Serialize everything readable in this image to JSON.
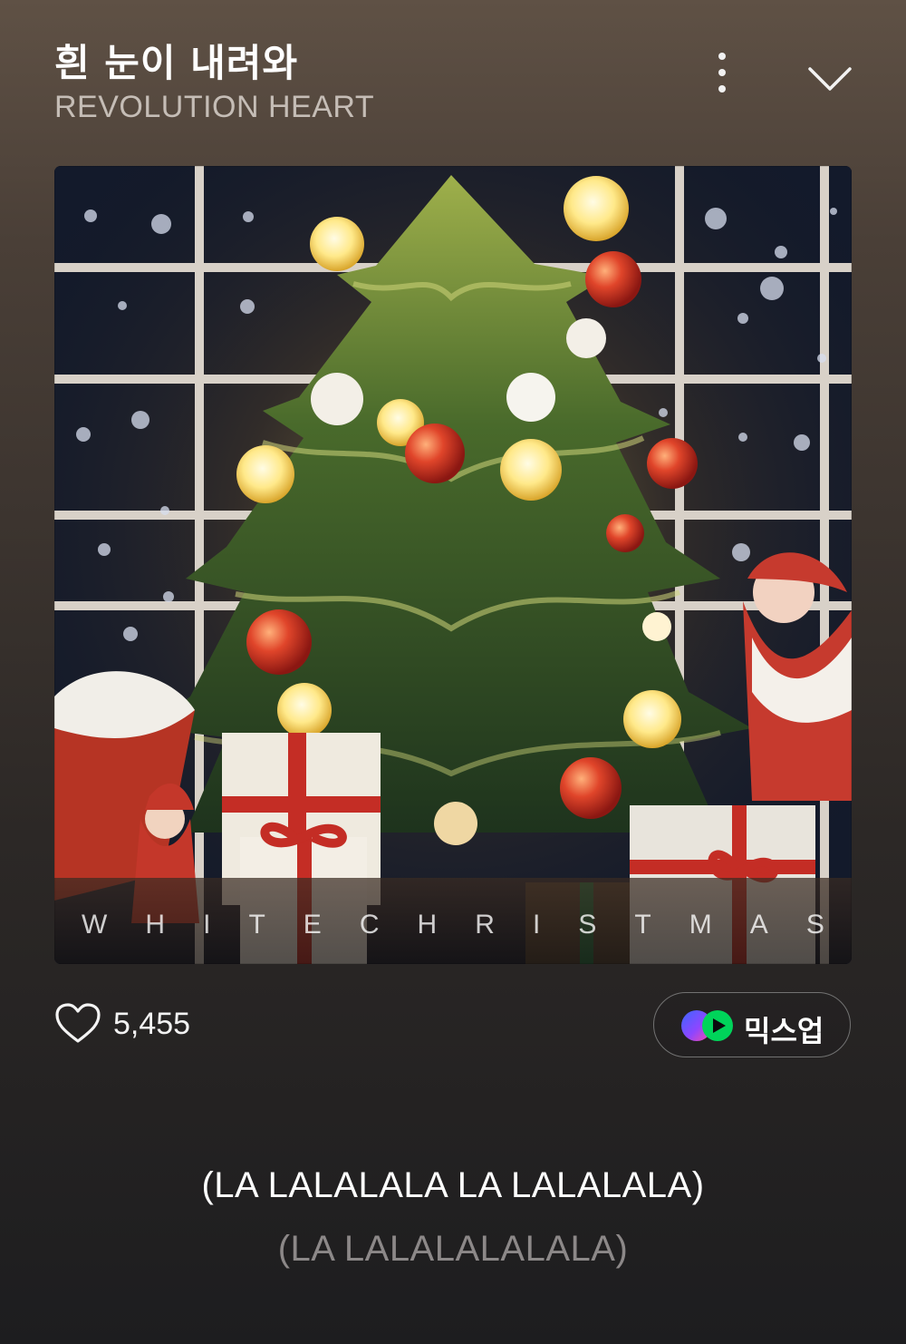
{
  "player": {
    "title": "흰 눈이 내려와",
    "artist": "REVOLUTION HEART",
    "more_icon": "more-vertical-icon",
    "collapse_icon": "chevron-down-icon"
  },
  "album": {
    "caption_letters": [
      "W",
      "H",
      "I",
      "T",
      "E",
      "C",
      "H",
      "R",
      "I",
      "S",
      "T",
      "M",
      "A",
      "S"
    ]
  },
  "actions": {
    "like_icon": "heart-outline-icon",
    "like_count": "5,455",
    "mixup_icon": "mixup-play-icon",
    "mixup_label": "믹스업"
  },
  "lyrics": {
    "current": "(LA LALALALA LA LALALALA)",
    "next": "(LA LALALALALALA)"
  },
  "colors": {
    "background_top": "#5f5145",
    "background_bottom": "#1d1d1f",
    "lyric_current": "#ffffff",
    "lyric_next": "#8c8888",
    "mixup_green": "#00d45a",
    "mixup_purple": "#8d46ff"
  }
}
